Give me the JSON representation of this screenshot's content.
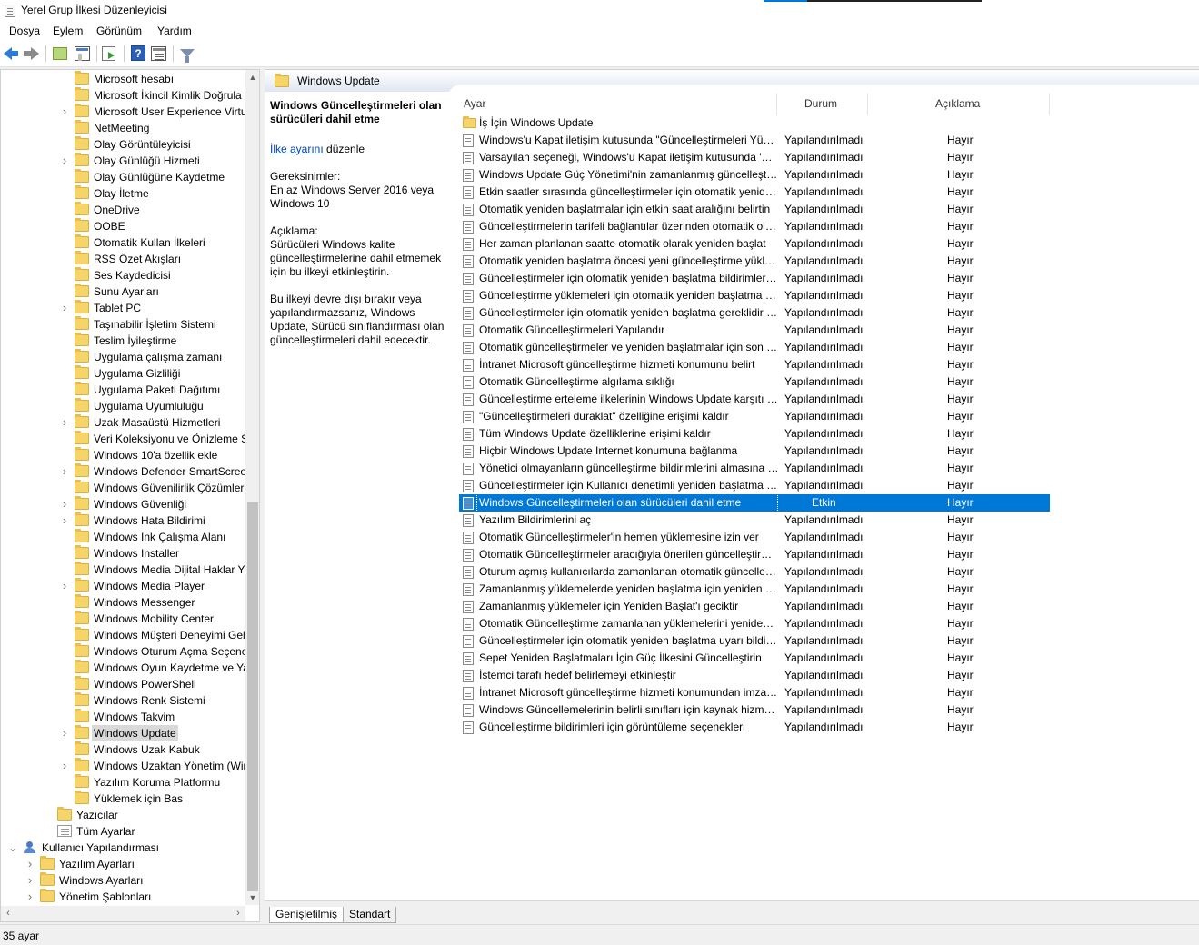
{
  "window": {
    "title": "Yerel Grup İlkesi Düzenleyicisi"
  },
  "menu": [
    "Dosya",
    "Eylem",
    "Görünüm",
    "Yardım"
  ],
  "toolbar": {
    "icons": [
      "back-arrow-icon",
      "forward-arrow-icon",
      "up-folder-icon",
      "show-hide-console-tree-icon",
      "export-list-icon",
      "help-icon",
      "properties-icon",
      "filter-icon"
    ],
    "help_glyph": "?"
  },
  "tree": {
    "items": [
      {
        "label": "Microsoft hesabı",
        "level": 4,
        "expandable": false,
        "icon": "folder"
      },
      {
        "label": "Microsoft İkincil Kimlik Doğrula",
        "level": 4,
        "expandable": false,
        "icon": "folder"
      },
      {
        "label": "Microsoft User Experience Virtu",
        "level": 4,
        "expandable": true,
        "icon": "folder"
      },
      {
        "label": "NetMeeting",
        "level": 4,
        "expandable": false,
        "icon": "folder"
      },
      {
        "label": "Olay Görüntüleyicisi",
        "level": 4,
        "expandable": false,
        "icon": "folder"
      },
      {
        "label": "Olay Günlüğü Hizmeti",
        "level": 4,
        "expandable": true,
        "icon": "folder"
      },
      {
        "label": "Olay Günlüğüne Kaydetme",
        "level": 4,
        "expandable": false,
        "icon": "folder"
      },
      {
        "label": "Olay İletme",
        "level": 4,
        "expandable": false,
        "icon": "folder"
      },
      {
        "label": "OneDrive",
        "level": 4,
        "expandable": false,
        "icon": "folder"
      },
      {
        "label": "OOBE",
        "level": 4,
        "expandable": false,
        "icon": "folder"
      },
      {
        "label": "Otomatik Kullan İlkeleri",
        "level": 4,
        "expandable": false,
        "icon": "folder"
      },
      {
        "label": "RSS Özet Akışları",
        "level": 4,
        "expandable": false,
        "icon": "folder"
      },
      {
        "label": "Ses Kaydedicisi",
        "level": 4,
        "expandable": false,
        "icon": "folder"
      },
      {
        "label": "Sunu Ayarları",
        "level": 4,
        "expandable": false,
        "icon": "folder"
      },
      {
        "label": "Tablet PC",
        "level": 4,
        "expandable": true,
        "icon": "folder"
      },
      {
        "label": "Taşınabilir İşletim Sistemi",
        "level": 4,
        "expandable": false,
        "icon": "folder"
      },
      {
        "label": "Teslim İyileştirme",
        "level": 4,
        "expandable": false,
        "icon": "folder"
      },
      {
        "label": "Uygulama çalışma zamanı",
        "level": 4,
        "expandable": false,
        "icon": "folder"
      },
      {
        "label": "Uygulama Gizliliği",
        "level": 4,
        "expandable": false,
        "icon": "folder"
      },
      {
        "label": "Uygulama Paketi Dağıtımı",
        "level": 4,
        "expandable": false,
        "icon": "folder"
      },
      {
        "label": "Uygulama Uyumluluğu",
        "level": 4,
        "expandable": false,
        "icon": "folder"
      },
      {
        "label": "Uzak Masaüstü Hizmetleri",
        "level": 4,
        "expandable": true,
        "icon": "folder"
      },
      {
        "label": "Veri Koleksiyonu ve Önizleme Sü",
        "level": 4,
        "expandable": false,
        "icon": "folder"
      },
      {
        "label": "Windows 10'a özellik ekle",
        "level": 4,
        "expandable": false,
        "icon": "folder"
      },
      {
        "label": "Windows Defender SmartScreen",
        "level": 4,
        "expandable": true,
        "icon": "folder"
      },
      {
        "label": "Windows Güvenilirlik Çözümler",
        "level": 4,
        "expandable": false,
        "icon": "folder"
      },
      {
        "label": "Windows Güvenliği",
        "level": 4,
        "expandable": true,
        "icon": "folder"
      },
      {
        "label": "Windows Hata Bildirimi",
        "level": 4,
        "expandable": true,
        "icon": "folder"
      },
      {
        "label": "Windows Ink Çalışma Alanı",
        "level": 4,
        "expandable": false,
        "icon": "folder"
      },
      {
        "label": "Windows Installer",
        "level": 4,
        "expandable": false,
        "icon": "folder"
      },
      {
        "label": "Windows Media Dijital Haklar Yö",
        "level": 4,
        "expandable": false,
        "icon": "folder"
      },
      {
        "label": "Windows Media Player",
        "level": 4,
        "expandable": true,
        "icon": "folder"
      },
      {
        "label": "Windows Messenger",
        "level": 4,
        "expandable": false,
        "icon": "folder"
      },
      {
        "label": "Windows Mobility Center",
        "level": 4,
        "expandable": false,
        "icon": "folder"
      },
      {
        "label": "Windows Müşteri Deneyimi Gel",
        "level": 4,
        "expandable": false,
        "icon": "folder"
      },
      {
        "label": "Windows Oturum Açma Seçene",
        "level": 4,
        "expandable": false,
        "icon": "folder"
      },
      {
        "label": "Windows Oyun Kaydetme ve Ya",
        "level": 4,
        "expandable": false,
        "icon": "folder"
      },
      {
        "label": "Windows PowerShell",
        "level": 4,
        "expandable": false,
        "icon": "folder"
      },
      {
        "label": "Windows Renk Sistemi",
        "level": 4,
        "expandable": false,
        "icon": "folder"
      },
      {
        "label": "Windows Takvim",
        "level": 4,
        "expandable": false,
        "icon": "folder"
      },
      {
        "label": "Windows Update",
        "level": 4,
        "expandable": true,
        "icon": "folder",
        "selected": true
      },
      {
        "label": "Windows Uzak Kabuk",
        "level": 4,
        "expandable": false,
        "icon": "folder"
      },
      {
        "label": "Windows Uzaktan Yönetim (Win",
        "level": 4,
        "expandable": true,
        "icon": "folder"
      },
      {
        "label": "Yazılım Koruma Platformu",
        "level": 4,
        "expandable": false,
        "icon": "folder"
      },
      {
        "label": "Yüklemek için Bas",
        "level": 4,
        "expandable": false,
        "icon": "folder"
      },
      {
        "label": "Yazıcılar",
        "level": 3,
        "expandable": false,
        "icon": "folder"
      },
      {
        "label": "Tüm Ayarlar",
        "level": 3,
        "expandable": false,
        "icon": "alldoc"
      },
      {
        "label": "Kullanıcı Yapılandırması",
        "level": 1,
        "expandable": true,
        "expanded": true,
        "icon": "user"
      },
      {
        "label": "Yazılım Ayarları",
        "level": 2,
        "expandable": true,
        "icon": "folder"
      },
      {
        "label": "Windows Ayarları",
        "level": 2,
        "expandable": true,
        "icon": "folder"
      },
      {
        "label": "Yönetim Şablonları",
        "level": 2,
        "expandable": true,
        "icon": "folder"
      }
    ]
  },
  "right_header": {
    "title": "Windows Update"
  },
  "description": {
    "title": "Windows Güncelleştirmeleri olan sürücüleri dahil etme",
    "edit_link": "İlke ayarını",
    "edit_suffix": " düzenle",
    "requirements_label": "Gereksinimler:",
    "requirements_text": "En az Windows Server 2016 veya Windows 10",
    "description_label": "Açıklama:",
    "description_p1": "Sürücüleri Windows kalite güncelleştirmelerine dahil etmemek için bu ilkeyi etkinleştirin.",
    "description_p2": "Bu ilkeyi devre dışı bırakır veya yapılandırmazsanız, Windows Update, Sürücü sınıflandırması olan güncelleştirmeleri dahil edecektir."
  },
  "list": {
    "columns": {
      "setting": "Ayar",
      "state": "Durum",
      "comment": "Açıklama"
    },
    "folder_row": "İş İçin Windows Update",
    "rows": [
      {
        "name": "Windows'u Kapat iletişim kutusunda \"Güncelleştirmeleri Yükle ve Kapat\" seçeneğini görüntüleme",
        "state": "Yapılandırılmadı",
        "comment": "Hayır"
      },
      {
        "name": "Varsayılan seçeneği, Windows'u Kapat iletişim kutusunda 'Güncelleştirmeleri Yükle ve Kapat' olarak ayarlama",
        "state": "Yapılandırılmadı",
        "comment": "Hayır"
      },
      {
        "name": "Windows Update Güç Yönetimi'nin zamanlanmış güncelleştirmeleri yüklemek için sistemi uyandırmasını etkinleştirme",
        "state": "Yapılandırılmadı",
        "comment": "Hayır"
      },
      {
        "name": "Etkin saatler sırasında güncelleştirmeler için otomatik yeniden başlatmayı kapat",
        "state": "Yapılandırılmadı",
        "comment": "Hayır"
      },
      {
        "name": "Otomatik yeniden başlatmalar için etkin saat aralığını belirtin",
        "state": "Yapılandırılmadı",
        "comment": "Hayır"
      },
      {
        "name": "Güncelleştirmelerin tarifeli bağlantılar üzerinden otomatik olarak indirilmesine izin ver",
        "state": "Yapılandırılmadı",
        "comment": "Hayır"
      },
      {
        "name": "Her zaman planlanan saatte otomatik olarak yeniden başlat",
        "state": "Yapılandırılmadı",
        "comment": "Hayır"
      },
      {
        "name": "Otomatik yeniden başlatma öncesi yeni güncelleştirme yükleme için son tarih belirtin",
        "state": "Yapılandırılmadı",
        "comment": "Hayır"
      },
      {
        "name": "Güncelleştirmeler için otomatik yeniden başlatma bildirimlerini yapılandırın",
        "state": "Yapılandırılmadı",
        "comment": "Hayır"
      },
      {
        "name": "Güncelleştirme yüklemeleri için otomatik yeniden başlatma bildirimlerini kapatın",
        "state": "Yapılandırılmadı",
        "comment": "Hayır"
      },
      {
        "name": "Güncelleştirmeler için otomatik yeniden başlatma gereklidir bildirimini yapılandırın",
        "state": "Yapılandırılmadı",
        "comment": "Hayır"
      },
      {
        "name": "Otomatik Güncelleştirmeleri Yapılandır",
        "state": "Yapılandırılmadı",
        "comment": "Hayır"
      },
      {
        "name": "Otomatik güncelleştirmeler ve yeniden başlatmalar için son tarihleri belirtin",
        "state": "Yapılandırılmadı",
        "comment": "Hayır"
      },
      {
        "name": "İntranet Microsoft güncelleştirme hizmeti konumunu belirt",
        "state": "Yapılandırılmadı",
        "comment": "Hayır"
      },
      {
        "name": "Otomatik Güncelleştirme algılama sıklığı",
        "state": "Yapılandırılmadı",
        "comment": "Hayır"
      },
      {
        "name": "Güncelleştirme erteleme ilkelerinin Windows Update karşıtı taramaya neden olmasına izin verme",
        "state": "Yapılandırılmadı",
        "comment": "Hayır"
      },
      {
        "name": "\"Güncelleştirmeleri duraklat\" özelliğine erişimi kaldır",
        "state": "Yapılandırılmadı",
        "comment": "Hayır"
      },
      {
        "name": "Tüm Windows Update özelliklerine erişimi kaldır",
        "state": "Yapılandırılmadı",
        "comment": "Hayır"
      },
      {
        "name": "Hiçbir Windows Update Internet konumuna bağlanma",
        "state": "Yapılandırılmadı",
        "comment": "Hayır"
      },
      {
        "name": "Yönetici olmayanların güncelleştirme bildirimlerini almasına izin ver",
        "state": "Yapılandırılmadı",
        "comment": "Hayır"
      },
      {
        "name": "Güncelleştirmeler için Kullanıcı denetimli yeniden başlatma süresi",
        "state": "Yapılandırılmadı",
        "comment": "Hayır"
      },
      {
        "name": "Windows Güncelleştirmeleri olan sürücüleri dahil etme",
        "state": "Etkin",
        "comment": "Hayır",
        "selected": true
      },
      {
        "name": "Yazılım Bildirimlerini aç",
        "state": "Yapılandırılmadı",
        "comment": "Hayır"
      },
      {
        "name": "Otomatik Güncelleştirmeler'in hemen yüklemesine izin ver",
        "state": "Yapılandırılmadı",
        "comment": "Hayır"
      },
      {
        "name": "Otomatik Güncelleştirmeler aracığıyla önerilen güncelleştirmeleri aç",
        "state": "Yapılandırılmadı",
        "comment": "Hayır"
      },
      {
        "name": "Oturum açmış kullanıcılarda zamanlanan otomatik güncelleştirme yüklemeleri için otomatik yeniden başlatma yok",
        "state": "Yapılandırılmadı",
        "comment": "Hayır"
      },
      {
        "name": "Zamanlanmış yüklemelerde yeniden başlatma için yeniden sor",
        "state": "Yapılandırılmadı",
        "comment": "Hayır"
      },
      {
        "name": "Zamanlanmış yüklemeler için Yeniden Başlat'ı geciktir",
        "state": "Yapılandırılmadı",
        "comment": "Hayır"
      },
      {
        "name": "Otomatik Güncelleştirme zamanlanan yüklemelerini yeniden zamanla",
        "state": "Yapılandırılmadı",
        "comment": "Hayır"
      },
      {
        "name": "Güncelleştirmeler için otomatik yeniden başlatma uyarı bildirimleri zamanlamasını yapılandır",
        "state": "Yapılandırılmadı",
        "comment": "Hayır"
      },
      {
        "name": "Sepet Yeniden Başlatmaları İçin Güç İlkesini Güncelleştirin",
        "state": "Yapılandırılmadı",
        "comment": "Hayır"
      },
      {
        "name": "İstemci tarafı hedef belirlemeyi etkinleştir",
        "state": "Yapılandırılmadı",
        "comment": "Hayır"
      },
      {
        "name": "İntranet Microsoft güncelleştirme hizmeti konumundan imzalanmış güncelleştirmelere izin ver",
        "state": "Yapılandırılmadı",
        "comment": "Hayır"
      },
      {
        "name": "Windows Güncellemelerinin belirli sınıfları için kaynak hizmetini belirtin",
        "state": "Yapılandırılmadı",
        "comment": "Hayır"
      },
      {
        "name": "Güncelleştirme bildirimleri için görüntüleme seçenekleri",
        "state": "Yapılandırılmadı",
        "comment": "Hayır"
      }
    ]
  },
  "tabs": [
    {
      "label": "Genişletilmiş",
      "active": true
    },
    {
      "label": "Standart",
      "active": false
    }
  ],
  "status": {
    "text": "35 ayar"
  },
  "colors": {
    "selection": "#0078d7",
    "link": "#0645ad",
    "folder": "#f5d56a"
  }
}
